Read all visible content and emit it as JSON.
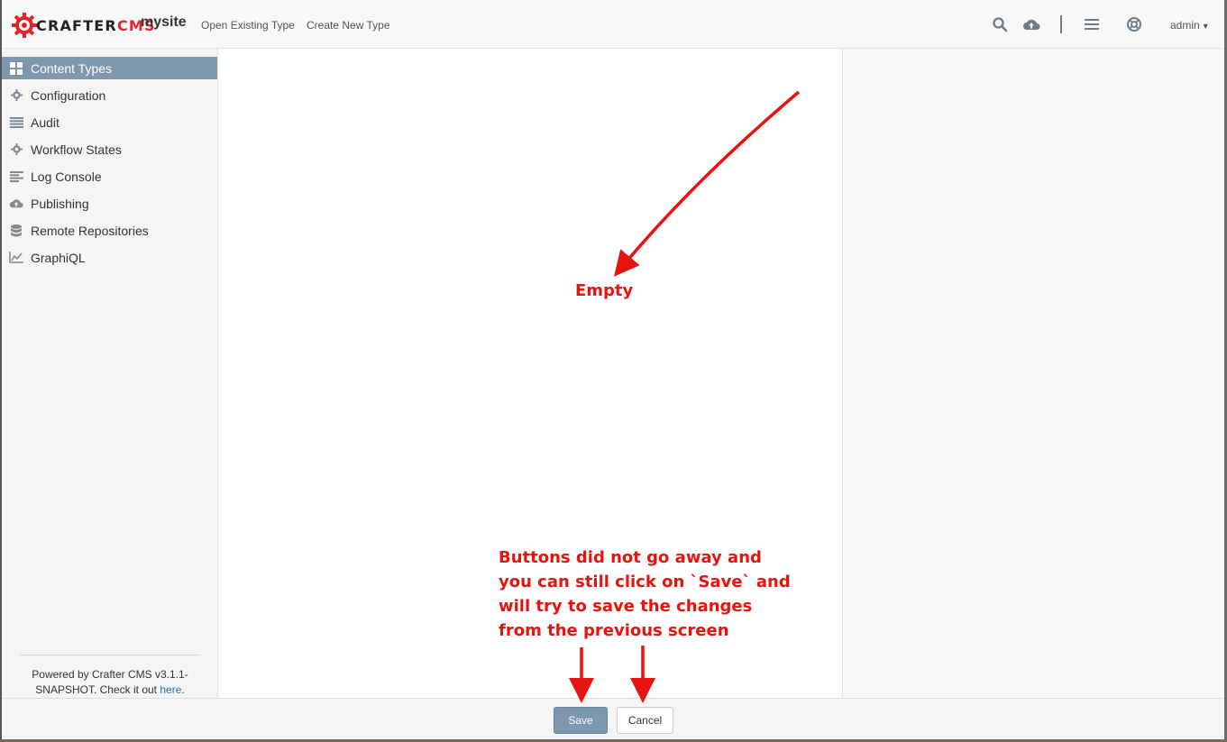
{
  "header": {
    "logo": {
      "crafter": "CRAFTER",
      "cms": "CMS",
      "brand_color": "#e0262b"
    },
    "site_name": "mysite",
    "nav": {
      "open_existing": "Open Existing Type",
      "create_new": "Create New Type"
    },
    "icons": [
      "search-icon",
      "cloud-upload-icon",
      "menu-icon",
      "help-icon"
    ],
    "user": "admin"
  },
  "sidebar": {
    "items": [
      {
        "label": "Content Types",
        "icon": "grid-icon",
        "active": true
      },
      {
        "label": "Configuration",
        "icon": "gear-icon"
      },
      {
        "label": "Audit",
        "icon": "list-icon"
      },
      {
        "label": "Workflow States",
        "icon": "gear-icon"
      },
      {
        "label": "Log Console",
        "icon": "align-left-icon"
      },
      {
        "label": "Publishing",
        "icon": "cloud-upload-icon"
      },
      {
        "label": "Remote Repositories",
        "icon": "database-icon"
      },
      {
        "label": "GraphiQL",
        "icon": "line-chart-icon"
      }
    ],
    "footer": {
      "text": "Powered by Crafter CMS v3.1.1-SNAPSHOT. Check it out",
      "link": "here",
      "end": "."
    }
  },
  "footer_buttons": {
    "save": "Save",
    "cancel": "Cancel"
  },
  "annotations": {
    "empty": "Empty",
    "note": [
      "Buttons did not go away and",
      "you can still click on `Save` and",
      "will try to save the changes",
      "from the previous screen"
    ],
    "color": "#e8120f"
  },
  "colors": {
    "accent": "#7d97b0",
    "sidebar_bg": "#f5f5f5",
    "header_bg": "#f8f8f8"
  }
}
